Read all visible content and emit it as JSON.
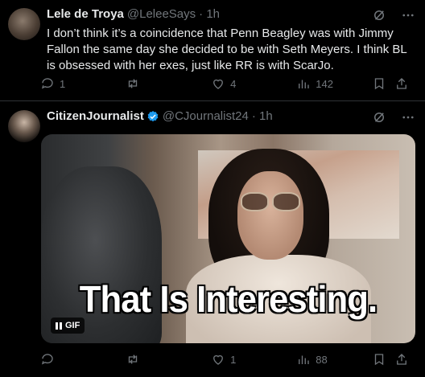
{
  "tweets": [
    {
      "author": {
        "name": "Lele de Troya",
        "handle": "@LeleeSays",
        "time": "· 1h"
      },
      "text": "I don’t think it’s a coincidence that Penn Beagley was with Jimmy Fallon the same day she decided to be with Seth Meyers. I think BL is obsessed with her exes, just like RR is with ScarJo.",
      "stats": {
        "replies": "1",
        "retweets": "",
        "likes": "4",
        "views": "142"
      }
    },
    {
      "author": {
        "name": "CitizenJournalist",
        "handle": "@CJournalist24",
        "time": "· 1h",
        "verified": true
      },
      "media": {
        "caption": "That Is Interesting.",
        "badge": "GIF"
      },
      "stats": {
        "replies": "",
        "retweets": "",
        "likes": "1",
        "views": "88"
      }
    }
  ],
  "colors": {
    "background": "#000000",
    "text": "#e7e9ea",
    "muted": "#71767b",
    "verified": "#1d9bf0",
    "divider": "#2f3336"
  }
}
